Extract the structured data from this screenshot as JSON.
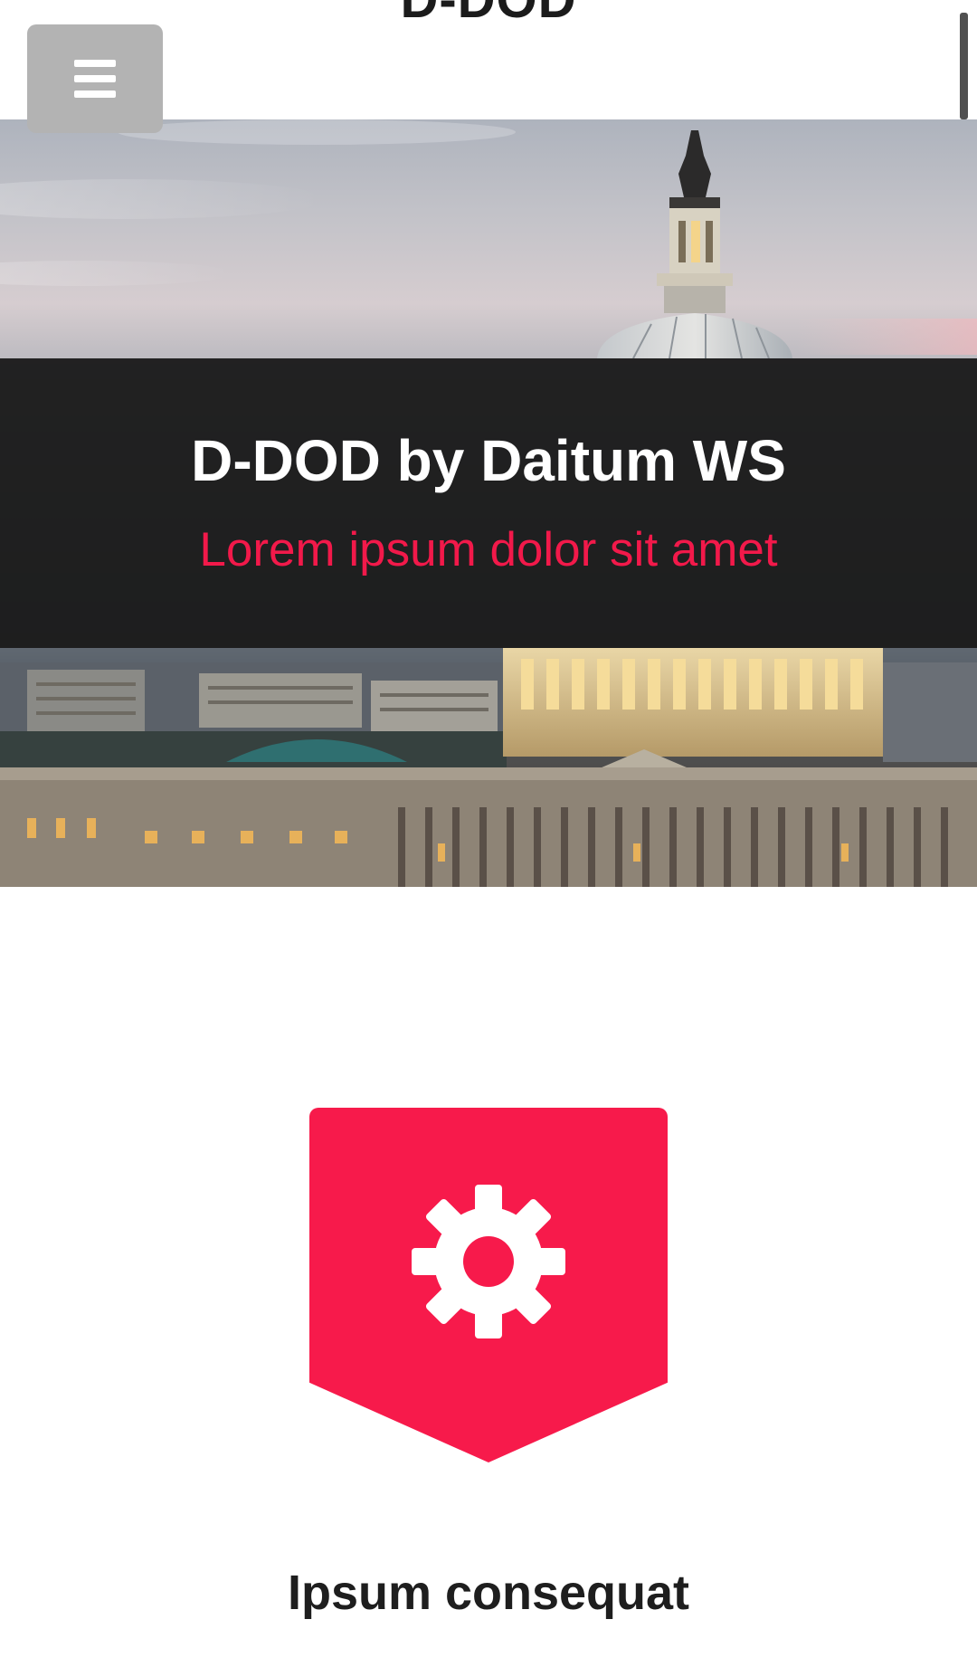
{
  "header": {
    "site_title": "D-DOD",
    "menu_icon": "hamburger-menu-icon"
  },
  "hero": {
    "title": "D-DOD by Daitum WS",
    "subtitle": "Lorem ipsum dolor sit amet"
  },
  "feature": {
    "icon": "gear-icon",
    "heading": "Ipsum consequat"
  },
  "colors": {
    "accent": "#f71a4b",
    "band": "#1b1b1b",
    "menu_button": "#b3b3b3"
  }
}
